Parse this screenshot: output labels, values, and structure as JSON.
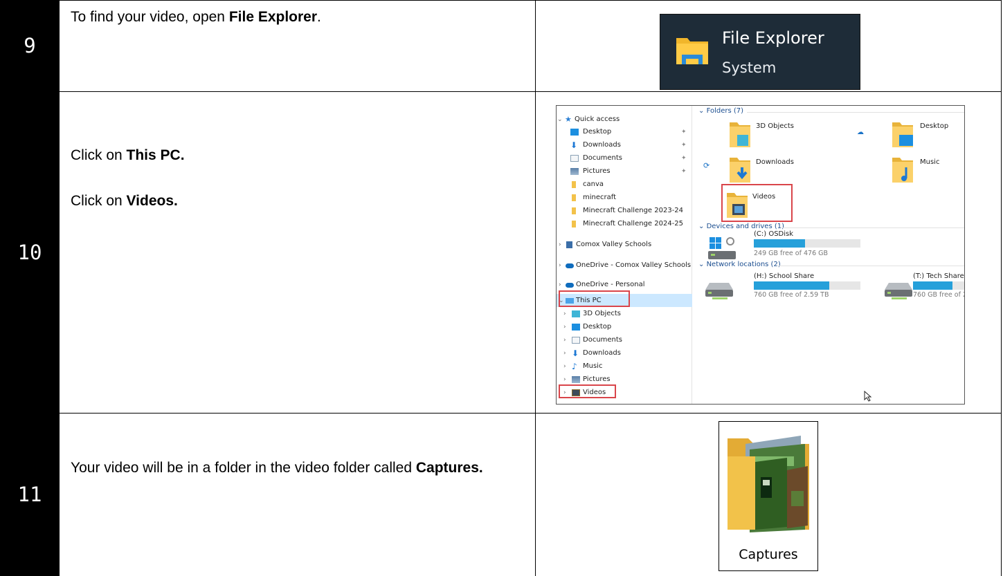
{
  "steps": [
    {
      "number": "9",
      "text_pre": "To find your video, open ",
      "text_bold": "File Explorer",
      "text_post": ".",
      "tile": {
        "title": "File Explorer",
        "subtitle": "System"
      }
    },
    {
      "number": "10",
      "line1_pre": "Click on ",
      "line1_bold": "This PC.",
      "line2_pre": "Click on ",
      "line2_bold": "Videos."
    },
    {
      "number": "11",
      "text_pre": " Your video will be in a folder in the video folder called ",
      "text_bold": "Captures.",
      "folder_label": "Captures"
    }
  ],
  "explorer": {
    "nav": {
      "quick_access": "Quick access",
      "quick_items": [
        "Desktop",
        "Downloads",
        "Documents",
        "Pictures",
        "canva",
        "minecraft",
        "Minecraft Challenge 2023-24",
        "Minecraft Challenge 2024-25"
      ],
      "comox_valley_schools": "Comox Valley Schools",
      "onedrive_cvs": "OneDrive - Comox Valley Schools",
      "onedrive_personal": "OneDrive - Personal",
      "this_pc": "This PC",
      "pc_items": [
        "3D Objects",
        "Desktop",
        "Documents",
        "Downloads",
        "Music",
        "Pictures",
        "Videos"
      ]
    },
    "folders_header": "Folders (7)",
    "folders": [
      "3D Objects",
      "Desktop",
      "Downloads",
      "Music",
      "Videos"
    ],
    "devices_header": "Devices and drives (1)",
    "drive": {
      "name": "(C:) OSDisk",
      "free": "249 GB free of 476 GB",
      "used_fraction": 0.48
    },
    "network_header": "Network locations (2)",
    "network": [
      {
        "name": "(H:) School Share",
        "free": "760 GB free of 2.59 TB",
        "used_fraction": 0.71
      },
      {
        "name": "(T:) Tech Share",
        "free": "760 GB free of 2",
        "used_fraction": 0.71
      }
    ]
  },
  "colors": {
    "number_cell_bg": "#000000",
    "tile_bg": "#1e2c38",
    "highlight": "#d9454a",
    "drive_fill": "#26a0da"
  }
}
